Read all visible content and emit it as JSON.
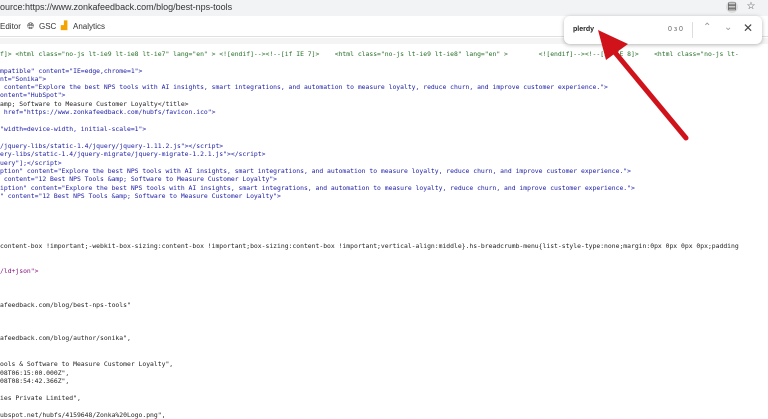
{
  "address_bar": {
    "url": "ource:https://www.zonkafeedback.com/blog/best-nps-tools"
  },
  "bookmarks": [
    {
      "label": "Editor"
    },
    {
      "label": "GSC"
    },
    {
      "label": "Analytics"
    }
  ],
  "find_bar": {
    "query": "plerdy",
    "count": "0 з 0"
  },
  "source_lines": [
    {
      "text": "f]> <html class=\"no-js lt-ie9 lt-ie8 lt-ie7\" lang=\"en\" > <![endif]--><!--[if IE 7]>    <html class=\"no-js lt-ie9 lt-ie8\" lang=\"en\" >        <![endif]--><!--[if IE 8]>    <html class=\"no-js lt-",
      "cls": "c"
    },
    {
      "text": "mpatible\" content=\"IE=edge,chrome=1\">",
      "cls": "b"
    },
    {
      "text": "nt=\"Sonika\">",
      "cls": "b"
    },
    {
      "text": " content=\"Explore the best NPS tools with AI insights, smart integrations, and automation to measure loyalty, reduce churn, and improve customer experience.\">",
      "cls": "b"
    },
    {
      "text": "ontent=\"HubSpot\">",
      "cls": "b"
    },
    {
      "text": "amp; Software to Measure Customer Loyalty</title>",
      "cls": ""
    },
    {
      "text": " href=\"https://www.zonkafeedback.com/hubfs/favicon.ico\">",
      "cls": "b"
    },
    {
      "text": "",
      "cls": ""
    },
    {
      "text": "\"width=device-width, initial-scale=1\">",
      "cls": "b"
    },
    {
      "text": "",
      "cls": ""
    },
    {
      "text": "/jquery-libs/static-1.4/jquery/jquery-1.11.2.js\"></script>",
      "cls": "b"
    },
    {
      "text": "ery-libs/static-1.4/jquery-migrate/jquery-migrate-1.2.1.js\"></script>",
      "cls": "b"
    },
    {
      "text": "uery\"];</script>",
      "cls": "b"
    },
    {
      "text": "ption\" content=\"Explore the best NPS tools with AI insights, smart integrations, and automation to measure loyalty, reduce churn, and improve customer experience.\">",
      "cls": "b"
    },
    {
      "text": " content=\"12 Best NPS Tools &amp; Software to Measure Customer Loyalty\">",
      "cls": "b"
    },
    {
      "text": "iption\" content=\"Explore the best NPS tools with AI insights, smart integrations, and automation to measure loyalty, reduce churn, and improve customer experience.\">",
      "cls": "b"
    },
    {
      "text": "\" content=\"12 Best NPS Tools &amp; Software to Measure Customer Loyalty\">",
      "cls": "b"
    }
  ],
  "lower_lines": [
    {
      "text": "content-box !important;-webkit-box-sizing:content-box !important;box-sizing:content-box !important;vertical-align:middle}.hs-breadcrumb-menu{list-style-type:none;margin:0px 0px 0px 0px;padding",
      "cls": ""
    },
    {
      "text": "/ld+json\">",
      "cls": "p"
    },
    {
      "text": "afeedback.com/blog/best-nps-tools\"",
      "cls": ""
    },
    {
      "text": "afeedback.com/blog/author/sonika\",",
      "cls": ""
    },
    {
      "text": "ools & Software to Measure Customer Loyalty\",",
      "cls": ""
    },
    {
      "text": "08T06:15:00.000Z\",",
      "cls": ""
    },
    {
      "text": "08T08:54:42.366Z\",",
      "cls": ""
    },
    {
      "text": "ies Private Limited\",",
      "cls": ""
    },
    {
      "text": "ubspot.net/hubfs/4159648/Zonka%20Logo.png\",",
      "cls": ""
    }
  ],
  "colors": {
    "arrow": "#d0121b"
  }
}
